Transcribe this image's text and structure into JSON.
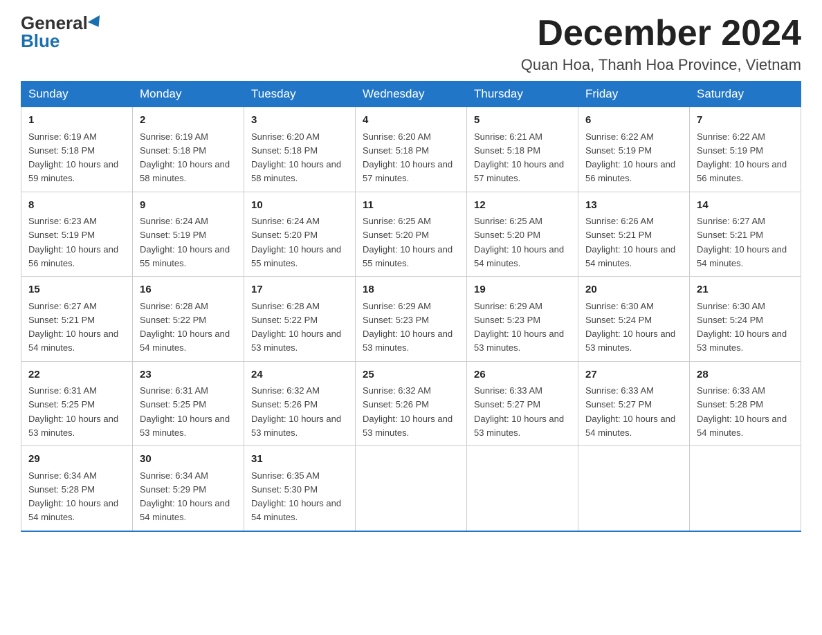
{
  "logo": {
    "general": "General",
    "blue": "Blue"
  },
  "header": {
    "month": "December 2024",
    "location": "Quan Hoa, Thanh Hoa Province, Vietnam"
  },
  "days_of_week": [
    "Sunday",
    "Monday",
    "Tuesday",
    "Wednesday",
    "Thursday",
    "Friday",
    "Saturday"
  ],
  "weeks": [
    [
      {
        "day": 1,
        "sunrise": "6:19 AM",
        "sunset": "5:18 PM",
        "daylight": "10 hours and 59 minutes."
      },
      {
        "day": 2,
        "sunrise": "6:19 AM",
        "sunset": "5:18 PM",
        "daylight": "10 hours and 58 minutes."
      },
      {
        "day": 3,
        "sunrise": "6:20 AM",
        "sunset": "5:18 PM",
        "daylight": "10 hours and 58 minutes."
      },
      {
        "day": 4,
        "sunrise": "6:20 AM",
        "sunset": "5:18 PM",
        "daylight": "10 hours and 57 minutes."
      },
      {
        "day": 5,
        "sunrise": "6:21 AM",
        "sunset": "5:18 PM",
        "daylight": "10 hours and 57 minutes."
      },
      {
        "day": 6,
        "sunrise": "6:22 AM",
        "sunset": "5:19 PM",
        "daylight": "10 hours and 56 minutes."
      },
      {
        "day": 7,
        "sunrise": "6:22 AM",
        "sunset": "5:19 PM",
        "daylight": "10 hours and 56 minutes."
      }
    ],
    [
      {
        "day": 8,
        "sunrise": "6:23 AM",
        "sunset": "5:19 PM",
        "daylight": "10 hours and 56 minutes."
      },
      {
        "day": 9,
        "sunrise": "6:24 AM",
        "sunset": "5:19 PM",
        "daylight": "10 hours and 55 minutes."
      },
      {
        "day": 10,
        "sunrise": "6:24 AM",
        "sunset": "5:20 PM",
        "daylight": "10 hours and 55 minutes."
      },
      {
        "day": 11,
        "sunrise": "6:25 AM",
        "sunset": "5:20 PM",
        "daylight": "10 hours and 55 minutes."
      },
      {
        "day": 12,
        "sunrise": "6:25 AM",
        "sunset": "5:20 PM",
        "daylight": "10 hours and 54 minutes."
      },
      {
        "day": 13,
        "sunrise": "6:26 AM",
        "sunset": "5:21 PM",
        "daylight": "10 hours and 54 minutes."
      },
      {
        "day": 14,
        "sunrise": "6:27 AM",
        "sunset": "5:21 PM",
        "daylight": "10 hours and 54 minutes."
      }
    ],
    [
      {
        "day": 15,
        "sunrise": "6:27 AM",
        "sunset": "5:21 PM",
        "daylight": "10 hours and 54 minutes."
      },
      {
        "day": 16,
        "sunrise": "6:28 AM",
        "sunset": "5:22 PM",
        "daylight": "10 hours and 54 minutes."
      },
      {
        "day": 17,
        "sunrise": "6:28 AM",
        "sunset": "5:22 PM",
        "daylight": "10 hours and 53 minutes."
      },
      {
        "day": 18,
        "sunrise": "6:29 AM",
        "sunset": "5:23 PM",
        "daylight": "10 hours and 53 minutes."
      },
      {
        "day": 19,
        "sunrise": "6:29 AM",
        "sunset": "5:23 PM",
        "daylight": "10 hours and 53 minutes."
      },
      {
        "day": 20,
        "sunrise": "6:30 AM",
        "sunset": "5:24 PM",
        "daylight": "10 hours and 53 minutes."
      },
      {
        "day": 21,
        "sunrise": "6:30 AM",
        "sunset": "5:24 PM",
        "daylight": "10 hours and 53 minutes."
      }
    ],
    [
      {
        "day": 22,
        "sunrise": "6:31 AM",
        "sunset": "5:25 PM",
        "daylight": "10 hours and 53 minutes."
      },
      {
        "day": 23,
        "sunrise": "6:31 AM",
        "sunset": "5:25 PM",
        "daylight": "10 hours and 53 minutes."
      },
      {
        "day": 24,
        "sunrise": "6:32 AM",
        "sunset": "5:26 PM",
        "daylight": "10 hours and 53 minutes."
      },
      {
        "day": 25,
        "sunrise": "6:32 AM",
        "sunset": "5:26 PM",
        "daylight": "10 hours and 53 minutes."
      },
      {
        "day": 26,
        "sunrise": "6:33 AM",
        "sunset": "5:27 PM",
        "daylight": "10 hours and 53 minutes."
      },
      {
        "day": 27,
        "sunrise": "6:33 AM",
        "sunset": "5:27 PM",
        "daylight": "10 hours and 54 minutes."
      },
      {
        "day": 28,
        "sunrise": "6:33 AM",
        "sunset": "5:28 PM",
        "daylight": "10 hours and 54 minutes."
      }
    ],
    [
      {
        "day": 29,
        "sunrise": "6:34 AM",
        "sunset": "5:28 PM",
        "daylight": "10 hours and 54 minutes."
      },
      {
        "day": 30,
        "sunrise": "6:34 AM",
        "sunset": "5:29 PM",
        "daylight": "10 hours and 54 minutes."
      },
      {
        "day": 31,
        "sunrise": "6:35 AM",
        "sunset": "5:30 PM",
        "daylight": "10 hours and 54 minutes."
      },
      null,
      null,
      null,
      null
    ]
  ]
}
